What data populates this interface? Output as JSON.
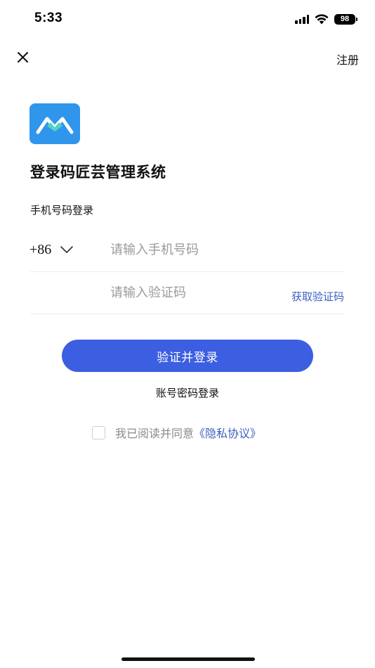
{
  "status_bar": {
    "time": "5:33",
    "battery_level": "98",
    "icons": [
      "signal-icon",
      "wifi-icon",
      "battery-icon"
    ]
  },
  "nav": {
    "close_icon": "close-icon",
    "register_label": "注册"
  },
  "logo": {
    "icon": "app-logo-icon",
    "brand_color": "#2f96ec"
  },
  "title": "登录码匠芸管理系统",
  "login_mode_label": "手机号码登录",
  "phone": {
    "country_code": "+86",
    "placeholder": "请输入手机号码",
    "value": ""
  },
  "code": {
    "placeholder": "请输入验证码",
    "value": "",
    "get_code_label": "获取验证码"
  },
  "primary_button": {
    "label": "验证并登录",
    "color": "#3c5ee1"
  },
  "password_login_label": "账号密码登录",
  "agreement": {
    "checked": false,
    "text": "我已阅读并同意",
    "link_text": "《隐私协议》",
    "link_color": "#3b5fc0"
  }
}
